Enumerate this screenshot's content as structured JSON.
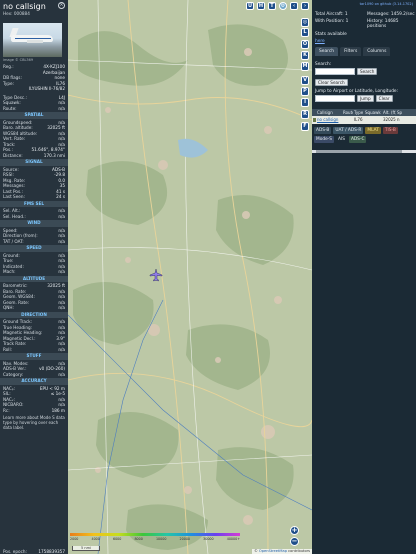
{
  "sidebar": {
    "callsign": "no callsign",
    "hex": "Hex: 000884",
    "close_icon": "close-icon",
    "photo_credit": "image © CBL369",
    "reg_rows": [
      {
        "k": "Reg.:",
        "v": "4X-KZJ100"
      },
      {
        "k": "",
        "v": "Azerbaijan"
      },
      {
        "k": "DB flags:",
        "v": "none"
      },
      {
        "k": "Type:",
        "v": "IL76"
      },
      {
        "k": "",
        "v": "ILYUSHIN Il-76/82"
      }
    ],
    "type_rows": [
      {
        "k": "Type Desc.:",
        "v": "L4J"
      },
      {
        "k": "Squawk:",
        "v": "n/a"
      },
      {
        "k": "Route:",
        "v": "n/a"
      }
    ],
    "sections": [
      {
        "title": "SPATIAL",
        "rows": [
          {
            "k": "Groundspeed:",
            "v": "n/a"
          },
          {
            "k": "Baro. altitude:",
            "v": "32025 ft"
          },
          {
            "k": "WGS84 altitude:",
            "v": "n/a"
          },
          {
            "k": "Vert. Rate:",
            "v": "n/a"
          },
          {
            "k": "Track:",
            "v": "n/a"
          },
          {
            "k": "Pos.:",
            "v": "51.646°, 8.974°"
          },
          {
            "k": "Distance:",
            "v": "170.3 nmi"
          }
        ]
      },
      {
        "title": "SIGNAL",
        "rows": [
          {
            "k": "Source:",
            "v": "ADS-B"
          },
          {
            "k": "RSSI:",
            "v": "-29.8"
          },
          {
            "k": "Msg. Rate:",
            "v": "0.0"
          },
          {
            "k": "Messages:",
            "v": "35"
          },
          {
            "k": "Last Pos.:",
            "v": "41 s"
          },
          {
            "k": "Last Seen:",
            "v": "24 s"
          }
        ]
      },
      {
        "title": "FMS SEL",
        "rows": [
          {
            "k": "Sel. Alt.:",
            "v": "n/a"
          },
          {
            "k": "Sel. Head.:",
            "v": "n/a"
          }
        ]
      },
      {
        "title": "WIND",
        "rows": [
          {
            "k": "Speed:",
            "v": "n/a"
          },
          {
            "k": "Direction (from):",
            "v": "n/a"
          },
          {
            "k": "TAT / OAT:",
            "v": "n/a"
          }
        ]
      },
      {
        "title": "SPEED",
        "rows": [
          {
            "k": "Ground:",
            "v": "n/a"
          },
          {
            "k": "True:",
            "v": "n/a"
          },
          {
            "k": "Indicated:",
            "v": "n/a"
          },
          {
            "k": "Mach:",
            "v": "n/a"
          }
        ]
      },
      {
        "title": "ALTITUDE",
        "rows": [
          {
            "k": "Barometric:",
            "v": "32025 ft"
          },
          {
            "k": "Baro. Rate:",
            "v": "n/a"
          },
          {
            "k": "Geom. WGS84:",
            "v": "n/a"
          },
          {
            "k": "Geom. Rate:",
            "v": "n/a"
          },
          {
            "k": "QNH:",
            "v": "n/a"
          }
        ]
      },
      {
        "title": "DIRECTION",
        "rows": [
          {
            "k": "Ground Track:",
            "v": "n/a"
          },
          {
            "k": "True Heading:",
            "v": "n/a"
          },
          {
            "k": "Magnetic Heading:",
            "v": "n/a"
          },
          {
            "k": "Magnetic Decl.:",
            "v": "3.9°"
          },
          {
            "k": "Track Rate:",
            "v": "n/a"
          },
          {
            "k": "Roll:",
            "v": "n/a"
          }
        ]
      },
      {
        "title": "STUFF",
        "rows": [
          {
            "k": "Nav. Modes:",
            "v": "n/a"
          },
          {
            "k": "ADS-B Ver.:",
            "v": "v0 (DO-260)"
          },
          {
            "k": "Category:",
            "v": "n/a"
          }
        ]
      },
      {
        "title": "ACCURACY",
        "rows": [
          {
            "k": "NACₚ:",
            "v": "EPU < 92 m"
          },
          {
            "k": "SIL:",
            "v": "≤ 1e-5"
          },
          {
            "k": "NACᵥ:",
            "v": "n/a"
          },
          {
            "k": "NICBARO:",
            "v": "n/a"
          },
          {
            "k": "Rc:",
            "v": "186 m"
          }
        ]
      }
    ],
    "note": "Learn more about Mode S data type by hovering over each data label.",
    "epoch_label": "Pos. epoch:",
    "epoch_value": "1758839357"
  },
  "map": {
    "top_buttons": [
      "U",
      "H",
      "T"
    ],
    "side_buttons": [
      "",
      "L",
      "O",
      "K",
      "M",
      "V",
      "P",
      "I",
      "R",
      "F"
    ],
    "nav_left_icon": "chevron-left-icon",
    "nav_right_icon": "chevron-right-icon",
    "zoom_in": "+",
    "zoom_out": "−",
    "scale_label": "5 nmi",
    "altitude_labels": [
      "2000",
      "4000",
      "6000",
      "8000",
      "10000",
      "20000",
      "30000",
      "40000+"
    ],
    "attribution_prefix": "©",
    "attribution_link": "OpenStreetMap",
    "attribution_suffix": "contributors"
  },
  "panel": {
    "top_link": "tar1090 on github (3.14.1702)",
    "stats": [
      {
        "k": "Total Aircraft: 1",
        "v": "Messages: 1459.2/sec"
      },
      {
        "k": "With Position: 1",
        "v": "History: 14685 positions"
      },
      {
        "k": "Stats available",
        "v": ""
      }
    ],
    "stats_link": "here",
    "tabs": [
      "Search",
      "Filters",
      "Columns"
    ],
    "search_label": "Search:",
    "search_placeholder": "",
    "search_button": "Search",
    "clear_search_button": "Clear Search",
    "jump_label": "Jump to Airport or Latitude, Longitude:",
    "jump_button": "Jump",
    "clear_button": "Clear",
    "table_headers": [
      "",
      "Callsign",
      "Route",
      "Type",
      "Squawk",
      "Alt. (ft)",
      "Sp"
    ],
    "table_rows": [
      [
        "",
        "no callsign",
        "",
        "IL76",
        "",
        "32025",
        "n"
      ]
    ],
    "chips": [
      {
        "label": "ADS-B",
        "color": "#344a5a"
      },
      {
        "label": "UAT / ADS-R",
        "color": "#3b5566"
      },
      {
        "label": "MLAT",
        "color": "#7a6a2a"
      },
      {
        "label": "TIS-B",
        "color": "#6a3a3a"
      },
      {
        "label": "Mode-S",
        "color": "#3a4a66"
      },
      {
        "label": "AIS",
        "color": "#1b2a35"
      },
      {
        "label": "ADS-C",
        "color": "#3a5a4a"
      }
    ]
  }
}
